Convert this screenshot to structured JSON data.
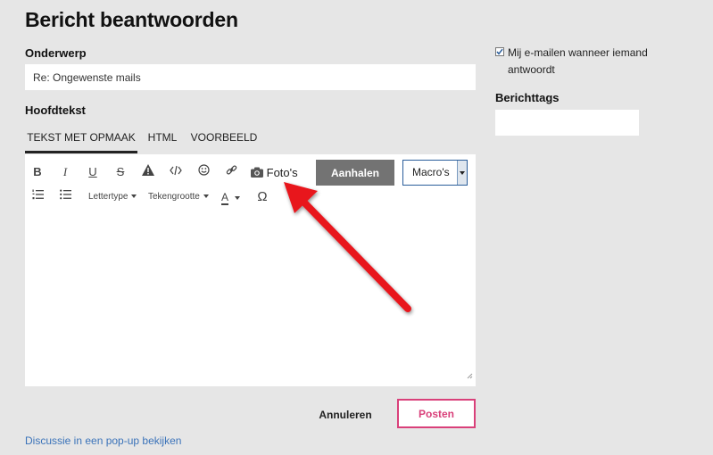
{
  "page": {
    "title": "Bericht beantwoorden"
  },
  "form": {
    "subject_label": "Onderwerp",
    "subject_value": "Re: Ongewenste mails",
    "body_label": "Hoofdtekst"
  },
  "tabs": [
    {
      "label": "TEKST MET OPMAAK",
      "active": true
    },
    {
      "label": "HTML",
      "active": false
    },
    {
      "label": "VOORBEELD",
      "active": false
    }
  ],
  "toolbar": {
    "bold": "B",
    "italic": "I",
    "underline": "U",
    "strike": "S",
    "fotos_label": "Foto's",
    "aanhalen_label": "Aanhalen",
    "macros_label": "Macro's",
    "font_label": "Lettertype",
    "fontsize_label": "Tekengrootte",
    "color_label": "A",
    "special_char": "Ω"
  },
  "actions": {
    "cancel_label": "Annuleren",
    "post_label": "Posten",
    "popup_link": "Discussie in een pop-up bekijken"
  },
  "sidebar": {
    "notify_label": "Mij e-mailen wanneer iemand antwoordt",
    "notify_checked": true,
    "tags_label": "Berichttags"
  },
  "colors": {
    "background": "#e6e6e6",
    "accent_pink": "#d9407a",
    "link_blue": "#3b73b9",
    "button_gray": "#737373",
    "annotation_arrow": "#e8141e"
  },
  "icons": [
    "bold-icon",
    "italic-icon",
    "underline-icon",
    "strikethrough-icon",
    "warning-icon",
    "code-icon",
    "smiley-icon",
    "link-icon",
    "camera-icon",
    "numbered-list-icon",
    "bullet-list-icon",
    "omega-icon",
    "resize-handle-icon"
  ]
}
